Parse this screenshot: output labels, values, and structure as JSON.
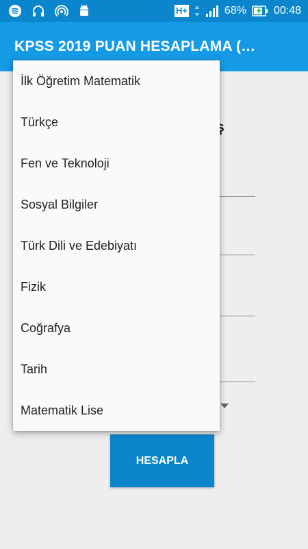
{
  "status_bar": {
    "left_icons": [
      "spotify-icon",
      "headset-icon",
      "hotspot-icon",
      "android-icon"
    ],
    "network": "H+",
    "battery": "68%",
    "time": "00:48"
  },
  "app_bar": {
    "title": "KPSS 2019 PUAN HESAPLAMA (…"
  },
  "background": {
    "heading_partial": "ş",
    "button_label": "HESAPLA"
  },
  "dropdown": {
    "items": [
      "İlk Öğretim Matematik",
      "Türkçe",
      "Fen ve Teknoloji",
      "Sosyal Bilgiler",
      "Türk Dili ve Edebiyatı",
      "Fizik",
      "Coğrafya",
      "Tarih",
      "Matematik Lise"
    ]
  }
}
